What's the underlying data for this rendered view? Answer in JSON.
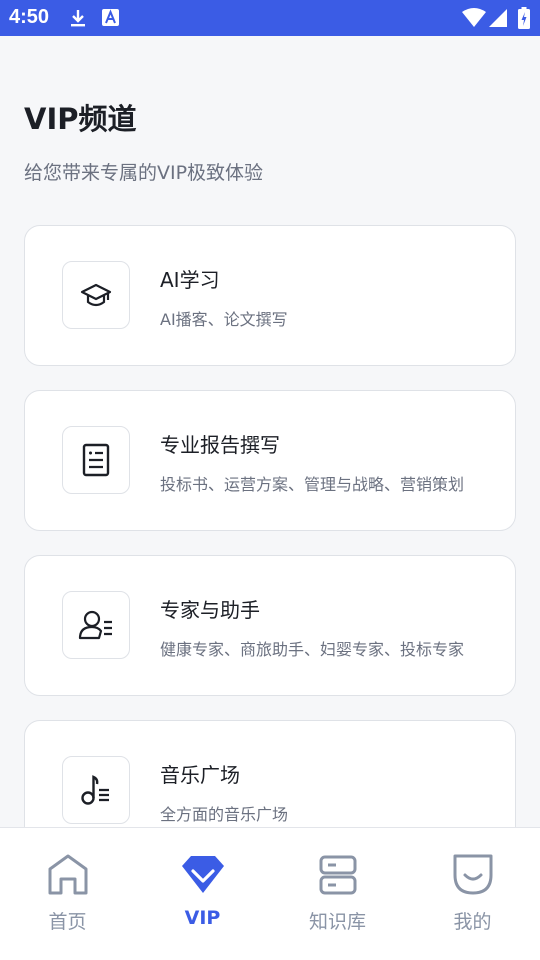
{
  "status_bar": {
    "time": "4:50"
  },
  "header": {
    "title": "VIP频道",
    "subtitle": "给您带来专属的VIP极致体验"
  },
  "cards": [
    {
      "title": "AI学习",
      "desc": "AI播客、论文撰写",
      "icon": "graduation-cap-icon"
    },
    {
      "title": "专业报告撰写",
      "desc": "投标书、运营方案、管理与战略、营销策划",
      "icon": "document-report-icon"
    },
    {
      "title": "专家与助手",
      "desc": "健康专家、商旅助手、妇婴专家、投标专家",
      "icon": "expert-user-icon"
    },
    {
      "title": "音乐广场",
      "desc": "全方面的音乐广场",
      "icon": "music-note-icon"
    }
  ],
  "tabbar": {
    "tabs": [
      {
        "label": "首页",
        "icon": "home-icon"
      },
      {
        "label": "VIP",
        "icon": "diamond-icon"
      },
      {
        "label": "知识库",
        "icon": "database-icon"
      },
      {
        "label": "我的",
        "icon": "profile-face-icon"
      }
    ],
    "active_index": 1
  },
  "colors": {
    "accent": "#3b5ce5",
    "text": "#1c1f26",
    "muted": "#6b7180",
    "inactive_tab": "#8a94a6"
  }
}
